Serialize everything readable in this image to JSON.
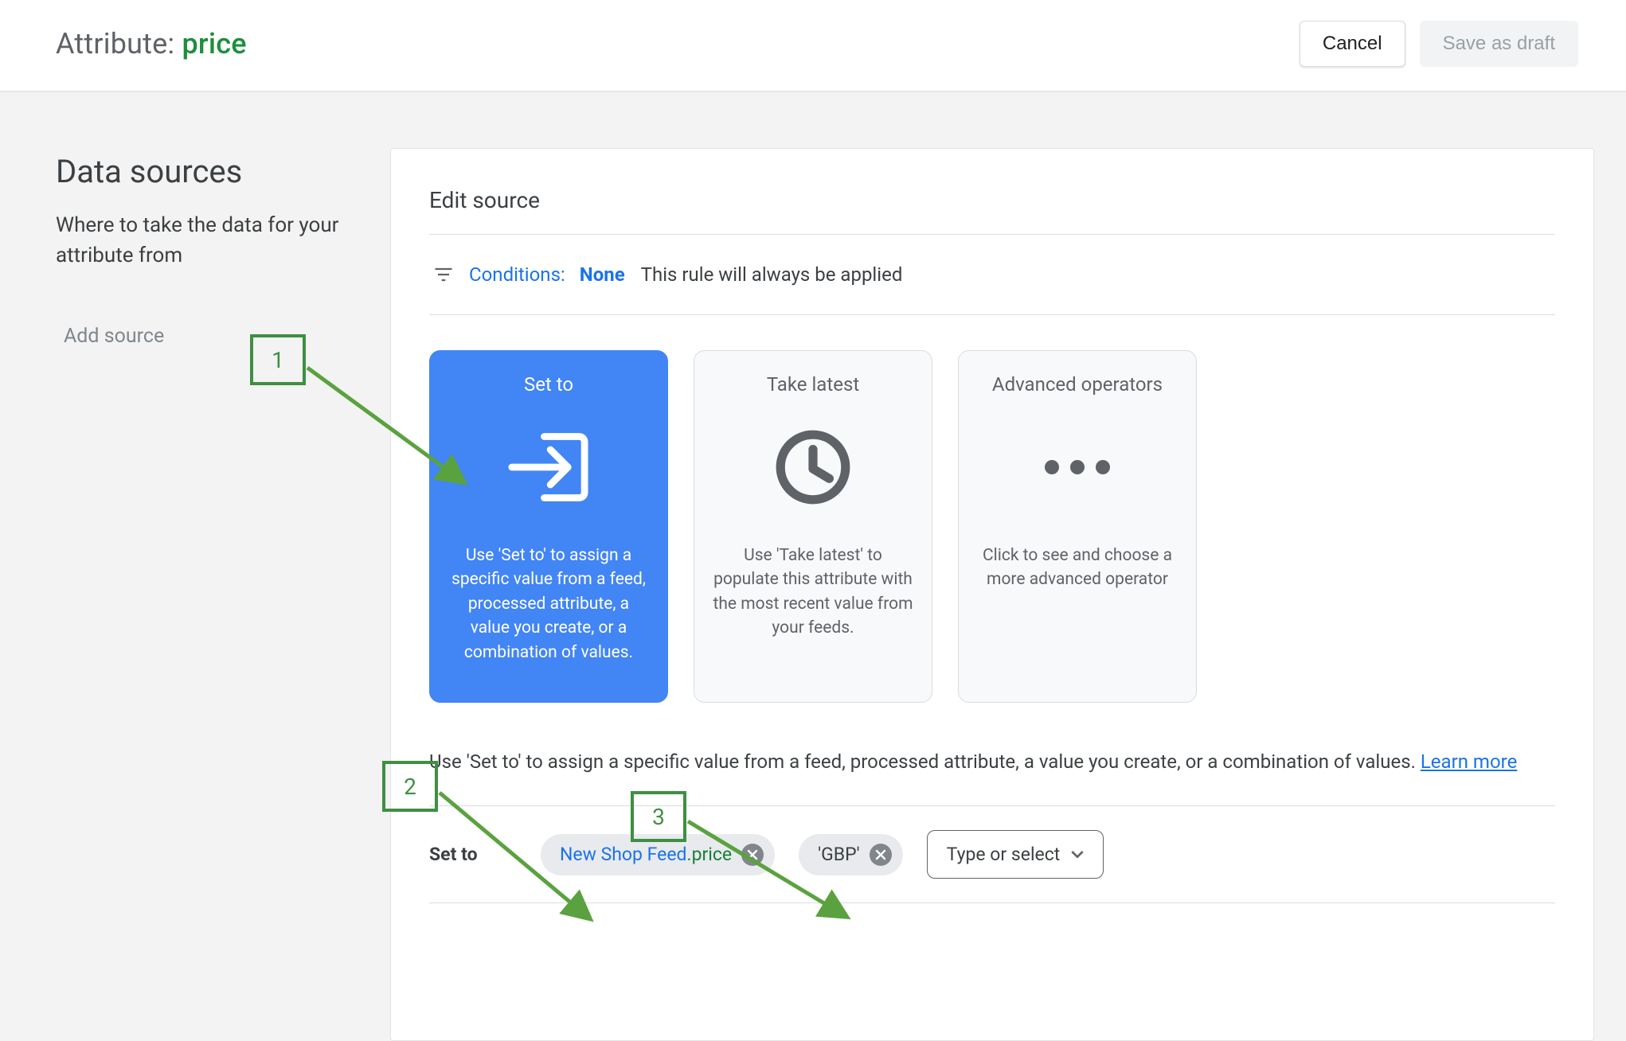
{
  "header": {
    "title_prefix": "Attribute: ",
    "attribute_name": "price",
    "cancel_label": "Cancel",
    "save_label": "Save as draft"
  },
  "sidebar": {
    "heading": "Data sources",
    "subtext": "Where to take the data for your attribute from",
    "add_source_label": "Add source"
  },
  "main": {
    "card_title": "Edit source",
    "conditions": {
      "label": "Conditions:",
      "value": "None",
      "desc": "This rule will always be applied"
    },
    "options": {
      "set_to": {
        "title": "Set to",
        "desc": "Use 'Set to' to assign a specific value from a feed, processed attribute, a value you create, or a combination of values."
      },
      "take_latest": {
        "title": "Take latest",
        "desc": "Use 'Take latest' to populate this attribute with the most recent value from your feeds."
      },
      "advanced": {
        "title": "Advanced operators",
        "desc": "Click to see and choose a more advanced operator"
      }
    },
    "explain": {
      "text": "Use 'Set to' to assign a specific value from a feed, processed attribute, a value you create, or a combination of values. ",
      "link_label": "Learn more"
    },
    "setto": {
      "label": "Set to",
      "chips": [
        {
          "feed": "New Shop Feed",
          "attr": ".price"
        },
        {
          "literal": "'GBP'"
        }
      ],
      "type_select_label": "Type or select"
    }
  },
  "annotations": {
    "a1": "1",
    "a2": "2",
    "a3": "3"
  }
}
